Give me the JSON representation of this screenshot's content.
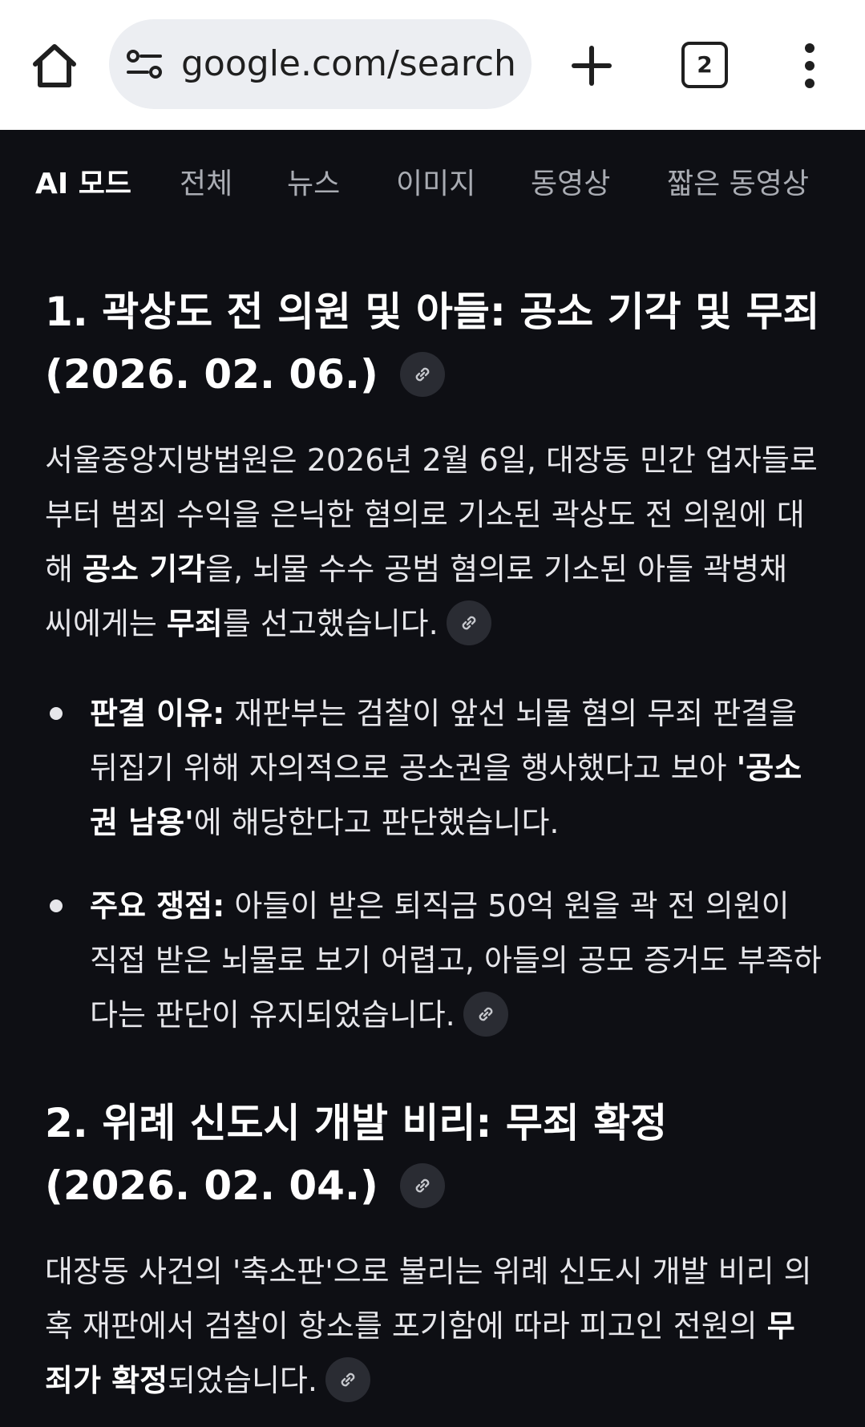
{
  "browser": {
    "url": "google.com/search?",
    "tab_count": "2"
  },
  "filters": [
    {
      "label": "AI 모드",
      "active": true
    },
    {
      "label": "전체"
    },
    {
      "label": "뉴스"
    },
    {
      "label": "이미지"
    },
    {
      "label": "동영상"
    },
    {
      "label": "짧은 동영상"
    }
  ],
  "section1": {
    "title": "1. 곽상도 전 의원 및 아들: 공소 기각 및 무죄 (2026. 02. 06.)",
    "para_a": "서울중앙지방법원은 2026년 2월 6일, 대장동 민간 업자들로부터 범죄 수익을 은닉한 혐의로 기소된 곽상도 전 의원에 대해 ",
    "para_b": "공소 기각",
    "para_c": "을, 뇌물 수수 공범 혐의로 기소된 아들 곽병채 씨에게는 ",
    "para_d": "무죄",
    "para_e": "를 선고했습니다.",
    "bullet1_label": "판결 이유:",
    "bullet1_a": " 재판부는 검찰이 앞선 뇌물 혐의 무죄 판결을 뒤집기 위해 자의적으로 공소권을 행사했다고 보아 ",
    "bullet1_b": "'공소권 남용'",
    "bullet1_c": "에 해당한다고 판단했습니다.",
    "bullet2_label": "주요 쟁점:",
    "bullet2_text": " 아들이 받은 퇴직금 50억 원을 곽 전 의원이 직접 받은 뇌물로 보기 어렵고, 아들의 공모 증거도 부족하다는 판단이 유지되었습니다."
  },
  "section2": {
    "title": "2. 위례 신도시 개발 비리: 무죄 확정 (2026. 02. 04.)",
    "para_a": "대장동 사건의 '축소판'으로 불리는 위례 신도시 개발 비리 의혹 재판에서 검찰이 항소를 포기함에 따라 피고인 전원의 ",
    "para_b": "무죄가 확정",
    "para_c": "되었습니다."
  },
  "icons": {
    "home": "home-icon",
    "site_settings": "tune-icon",
    "new_tab": "plus-icon",
    "menu": "more-vert-icon",
    "source_link": "link-icon"
  }
}
